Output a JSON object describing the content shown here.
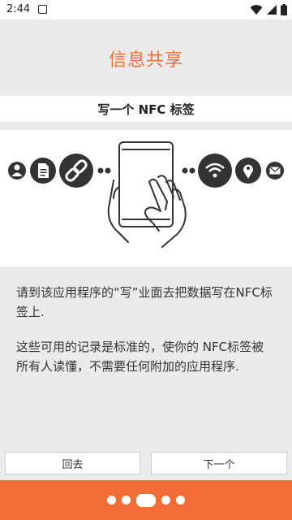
{
  "status_bar": {
    "time": "2:44",
    "icons": [
      "notification-a-icon",
      "wifi-icon",
      "signal-icon",
      "battery-icon"
    ]
  },
  "page": {
    "title": "信息共享",
    "section_header": "写一个 NFC 标签",
    "description_1": "请到该应用程序的“写”业面去把数据写在NFC标签上.",
    "description_2": "这些可用的记录是标准的，使你的 NFC标签被所有人读懂，不需要任何附加的应用程序."
  },
  "illustration": {
    "left_icons": [
      "person-icon",
      "document-icon",
      "link-icon"
    ],
    "right_icons": [
      "wifi-icon",
      "location-pin-icon",
      "mail-icon"
    ],
    "center": "hand-holding-phone-icon"
  },
  "buttons": {
    "back": "回去",
    "next": "下一个"
  },
  "pager": {
    "count": 5,
    "active_index": 2
  },
  "colors": {
    "accent": "#f26d35",
    "icon_dark": "#333333",
    "background": "#ebebeb"
  }
}
